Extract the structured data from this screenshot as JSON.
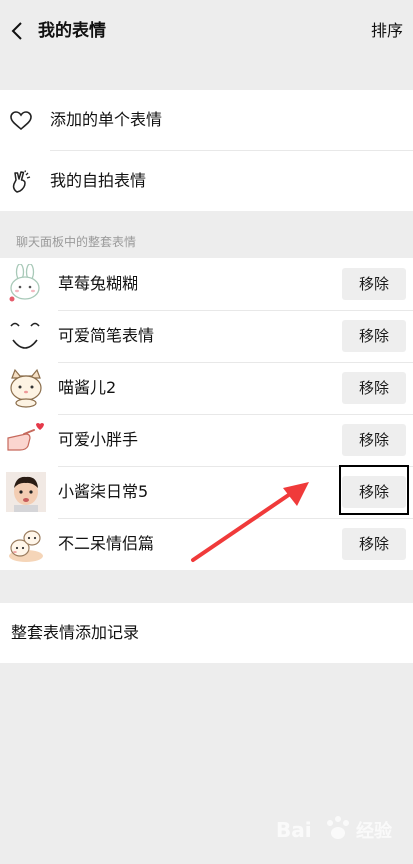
{
  "header": {
    "title": "我的表情",
    "sort_label": "排序"
  },
  "menu": [
    {
      "label": "添加的单个表情",
      "icon": "heart-icon"
    },
    {
      "label": "我的自拍表情",
      "icon": "hand-gesture-icon"
    }
  ],
  "section": {
    "label": "聊天面板中的整套表情"
  },
  "sets": [
    {
      "name": "草莓兔糊糊",
      "remove_label": "移除",
      "thumb": "bunny-thumb"
    },
    {
      "name": "可爱简笔表情",
      "remove_label": "移除",
      "thumb": "smile-thumb"
    },
    {
      "name": "喵酱儿2",
      "remove_label": "移除",
      "thumb": "cat-thumb"
    },
    {
      "name": "可爱小胖手",
      "remove_label": "移除",
      "thumb": "hand-thumb"
    },
    {
      "name": "小酱柒日常5",
      "remove_label": "移除",
      "thumb": "baby-thumb"
    },
    {
      "name": "不二呆情侣篇",
      "remove_label": "移除",
      "thumb": "couple-thumb"
    }
  ],
  "history": {
    "label": "整套表情添加记录"
  },
  "colors": {
    "accent_arrow": "#f03a3a",
    "background": "#ededed",
    "button_bg": "#eeeeee"
  }
}
